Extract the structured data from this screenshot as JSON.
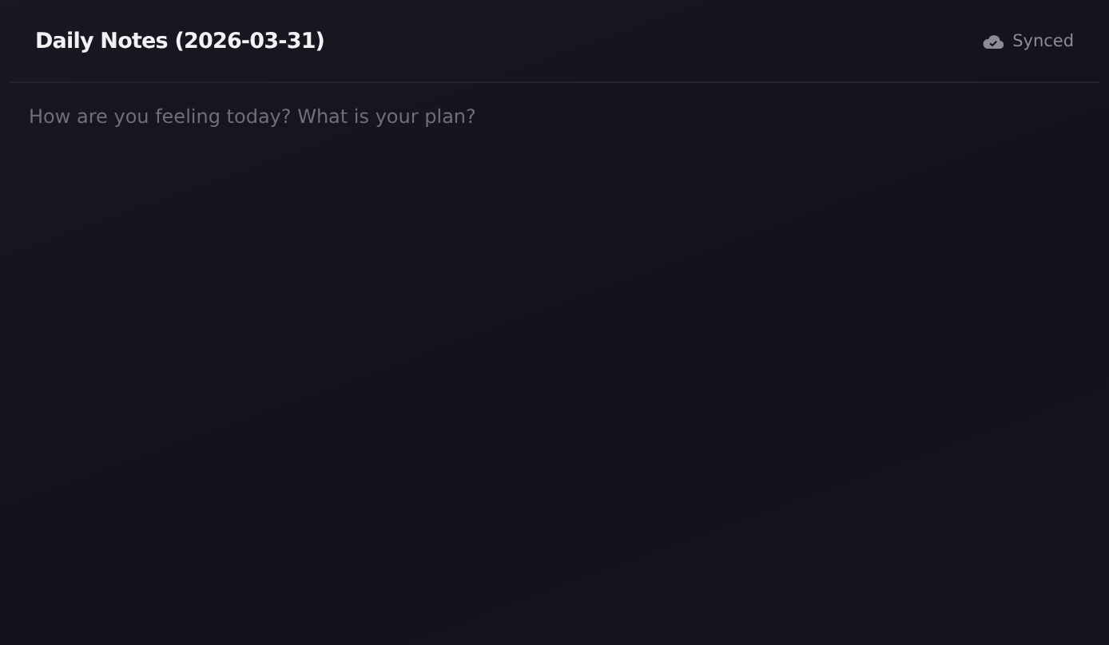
{
  "header": {
    "title": "Daily Notes (2026-03-31)",
    "sync_status": "Synced"
  },
  "editor": {
    "placeholder": "How are you feeling today? What is your plan?"
  }
}
